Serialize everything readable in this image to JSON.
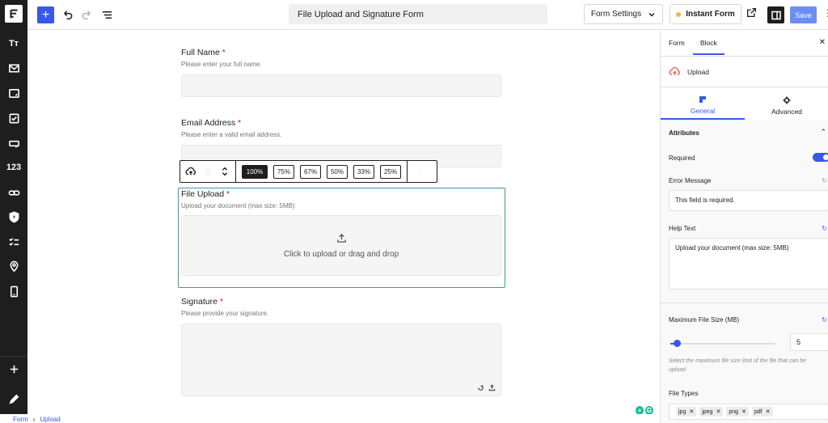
{
  "toolbar": {
    "doc_title": "File Upload and Signature Form",
    "form_settings": "Form Settings",
    "instant_form": "Instant Form",
    "save": "Save"
  },
  "sidebar": {
    "text_icon_label": "Tт",
    "number_label": "123"
  },
  "fields": {
    "full_name": {
      "label": "Full Name",
      "help": "Please enter your full name."
    },
    "email": {
      "label": "Email Address",
      "help": "Please enter a valid email address."
    },
    "file_upload": {
      "label": "File Upload",
      "help": "Upload your document (max size: 5MB)",
      "dropzone": "Click to upload or drag and drop"
    },
    "signature": {
      "label": "Signature",
      "help": "Please provide your signature."
    },
    "required_marker": "*"
  },
  "block_toolbar": {
    "widths": [
      "100%",
      "75%",
      "67%",
      "50%",
      "33%",
      "25%"
    ],
    "active_width": "100%"
  },
  "panel": {
    "tab_form": "Form",
    "tab_block": "Block",
    "block_name": "Upload",
    "subtab_general": "General",
    "subtab_advanced": "Advanced",
    "attributes": "Attributes",
    "required_label": "Required",
    "required_on": true,
    "error_message_label": "Error Message",
    "error_message_value": "This field is required.",
    "help_text_label": "Help Text",
    "help_text_value": "Upload your document (max size: 5MB)",
    "max_size_label": "Maximum File Size (MB)",
    "max_size_value": "5",
    "max_size_fraction": 0.05,
    "max_size_note": "Select the maximum file size limit of the file that can be upload",
    "file_types_label": "File Types",
    "file_types": [
      "jpg",
      "jpeg",
      "png",
      "pdf"
    ]
  },
  "breadcrumb": {
    "root": "Form",
    "current": "Upload",
    "sep": "›"
  },
  "colors": {
    "accent": "#3858e9",
    "selected_outline": "#3899a7",
    "upload_icon": "#e26f56",
    "required": "#cc1818"
  }
}
